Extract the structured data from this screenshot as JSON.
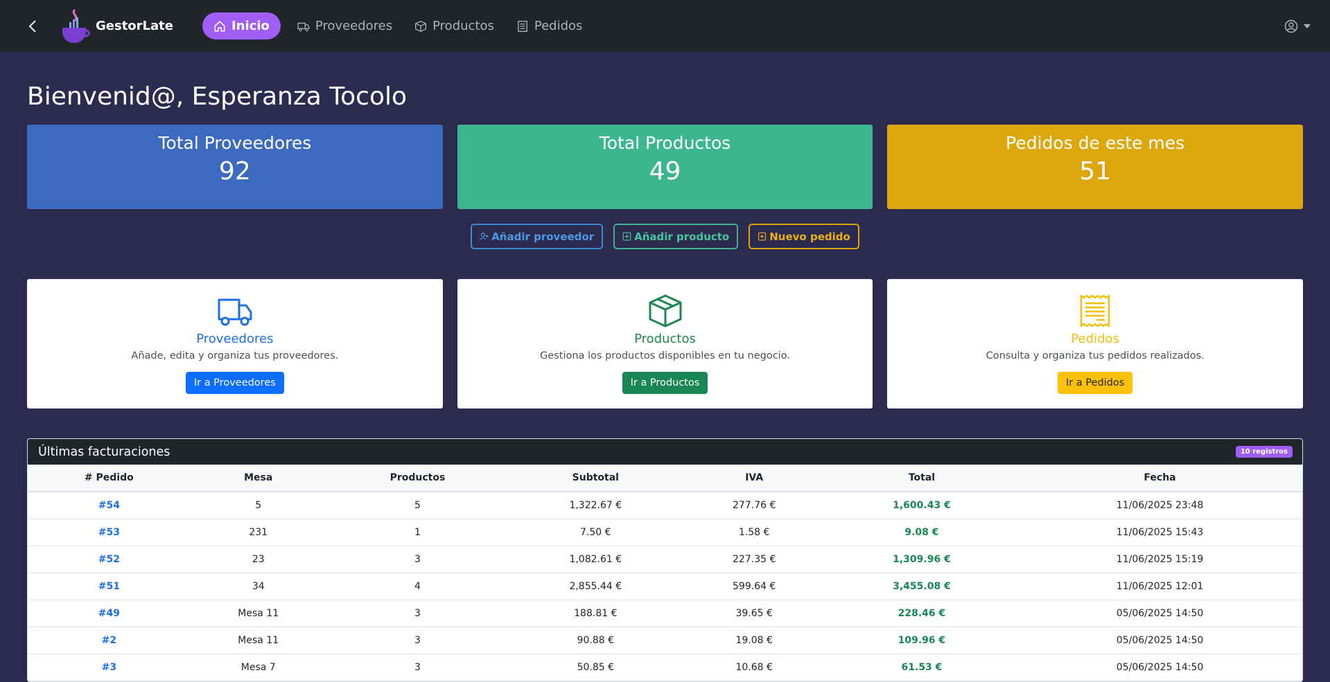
{
  "nav": {
    "brand": "GestorLate",
    "items": [
      {
        "label": "Inicio",
        "icon": "home-icon"
      },
      {
        "label": "Proveedores",
        "icon": "truck-icon"
      },
      {
        "label": "Productos",
        "icon": "box-icon"
      },
      {
        "label": "Pedidos",
        "icon": "receipt-icon"
      }
    ]
  },
  "welcome": "Bienvenid@, Esperanza Tocolo",
  "stats": [
    {
      "label": "Total Proveedores",
      "value": "92",
      "color": "#3b6abf"
    },
    {
      "label": "Total Productos",
      "value": "49",
      "color": "#3bb68f"
    },
    {
      "label": "Pedidos de este mes",
      "value": "51",
      "color": "#dca70c"
    }
  ],
  "quick_actions": [
    {
      "label": "Añadir proveedor",
      "icon": "person-plus-icon"
    },
    {
      "label": "Añadir producto",
      "icon": "plus-square-icon"
    },
    {
      "label": "Nuevo pedido",
      "icon": "file-plus-icon"
    }
  ],
  "cards": [
    {
      "title": "Proveedores",
      "desc": "Añade, edita y organiza tus proveedores.",
      "button": "Ir a Proveedores",
      "icon": "truck-icon"
    },
    {
      "title": "Productos",
      "desc": "Gestiona los productos disponibles en tu negocio.",
      "button": "Ir a Productos",
      "icon": "box-icon"
    },
    {
      "title": "Pedidos",
      "desc": "Consulta y organiza tus pedidos realizados.",
      "button": "Ir a Pedidos",
      "icon": "receipt-icon"
    }
  ],
  "invoices": {
    "title": "Últimas facturaciones",
    "badge": "10 registros",
    "columns": [
      "# Pedido",
      "Mesa",
      "Productos",
      "Subtotal",
      "IVA",
      "Total",
      "Fecha"
    ],
    "rows": [
      [
        "#54",
        "5",
        "5",
        "1,322.67 €",
        "277.76 €",
        "1,600.43 €",
        "11/06/2025 23:48"
      ],
      [
        "#53",
        "231",
        "1",
        "7.50 €",
        "1.58 €",
        "9.08 €",
        "11/06/2025 15:43"
      ],
      [
        "#52",
        "23",
        "3",
        "1,082.61 €",
        "227.35 €",
        "1,309.96 €",
        "11/06/2025 15:19"
      ],
      [
        "#51",
        "34",
        "4",
        "2,855.44 €",
        "599.64 €",
        "3,455.08 €",
        "11/06/2025 12:01"
      ],
      [
        "#49",
        "Mesa 11",
        "3",
        "188.81 €",
        "39.65 €",
        "228.46 €",
        "05/06/2025 14:50"
      ],
      [
        "#2",
        "Mesa 11",
        "3",
        "90.88 €",
        "19.08 €",
        "109.96 €",
        "05/06/2025 14:50"
      ],
      [
        "#3",
        "Mesa 7",
        "3",
        "50.85 €",
        "10.68 €",
        "61.53 €",
        "05/06/2025 14:50"
      ]
    ]
  }
}
